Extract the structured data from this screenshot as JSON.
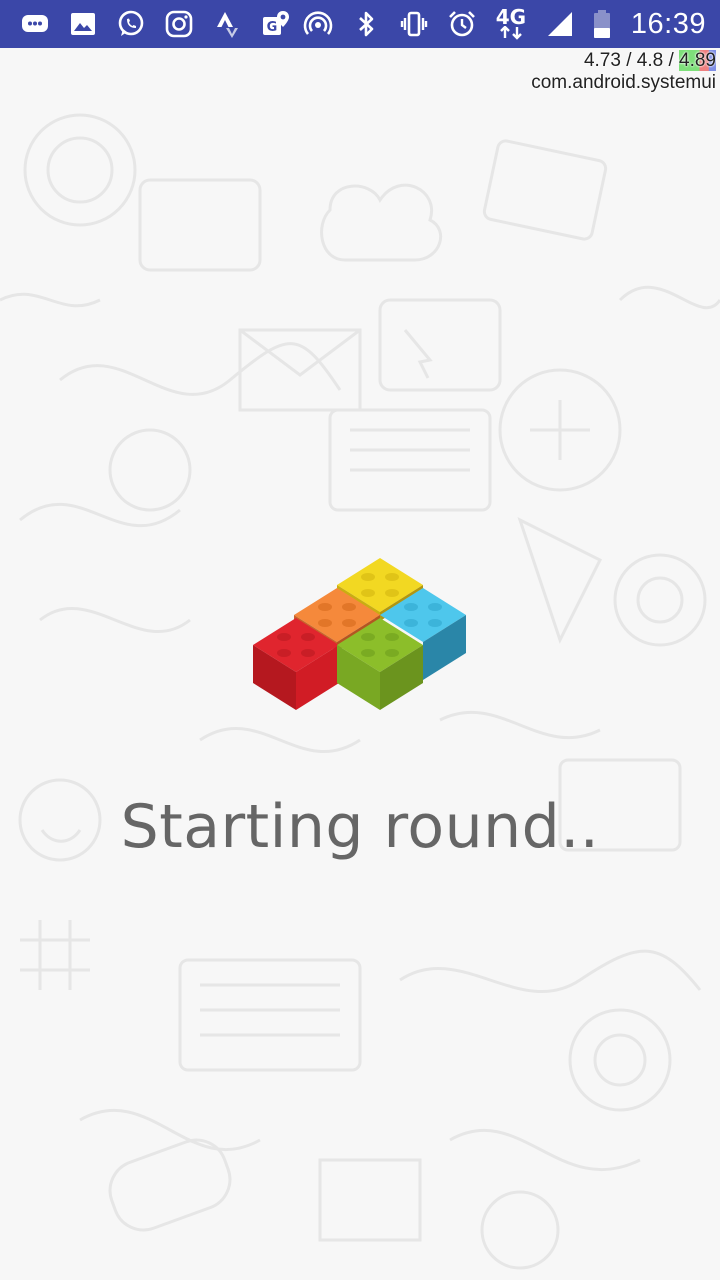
{
  "status_bar": {
    "time": "16:39",
    "network_label": "4G",
    "left_icons": [
      "messages-icon",
      "gallery-icon",
      "whatsapp-icon",
      "instagram-icon",
      "strava-icon",
      "maps-icon"
    ],
    "right_icons": [
      "hotspot-icon",
      "bluetooth-icon",
      "vibrate-icon",
      "alarm-icon",
      "network-4g-icon",
      "signal-icon",
      "battery-icon"
    ]
  },
  "debug_overlay": {
    "load_values": "4.73 / 4.8 / ",
    "load_value_highlight": "4.89",
    "process_name": "com.android.systemui"
  },
  "main": {
    "status_text": "Starting round..",
    "logo_name": "lego-bricks-logo",
    "brick_colors": {
      "red": "#e0252e",
      "orange": "#f5893b",
      "yellow": "#f2d822",
      "green": "#8cbe2a",
      "blue": "#4ec7ec"
    }
  }
}
